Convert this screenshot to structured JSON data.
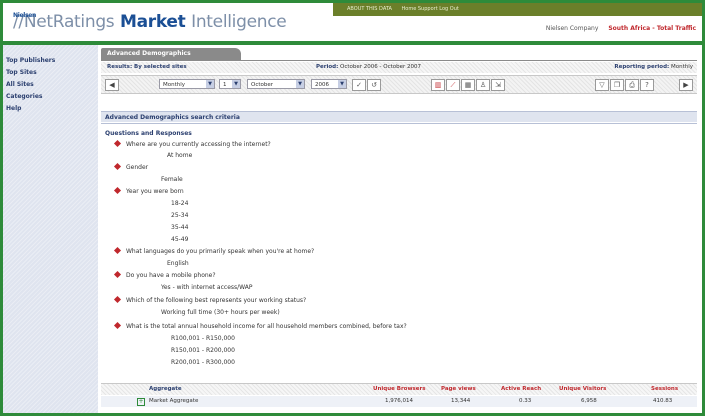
{
  "header": {
    "logo_part1": "Nielsen",
    "logo_part2": "//",
    "logo_part3": "NetRatings",
    "logo_part4": "Market",
    "logo_part5": "Intelligence",
    "topband_left": "ABOUT THIS DATA",
    "topband_right": "Home  Support  Log Out",
    "company": "Nielsen Company",
    "region": "South Africa - Total Traffic"
  },
  "sidebar": {
    "items": [
      {
        "label": "Top Publishers"
      },
      {
        "label": "Top Sites"
      },
      {
        "label": "All Sites"
      },
      {
        "label": "Categories"
      },
      {
        "label": "Help"
      }
    ]
  },
  "main": {
    "tab_label": "Advanced Demographics",
    "info": {
      "left": "Results: By selected sites",
      "period_label": "Period:",
      "period_value": "October 2006 - October 2007",
      "reporting_label": "Reporting period:",
      "reporting_value": "Monthly"
    },
    "toolbar": {
      "frequency": "Monthly",
      "day": "1",
      "month": "October",
      "year": "2006"
    },
    "section_title": "Advanced Demographics search criteria",
    "qa_title": "Questions and Responses",
    "questions": [
      {
        "q": "Where are you currently accessing the internet?",
        "answers": [
          "At home"
        ]
      },
      {
        "q": "Gender",
        "answers": [
          "Female"
        ]
      },
      {
        "q": "Year you were born",
        "answers": [
          "18-24",
          "25-34",
          "35-44",
          "45-49"
        ]
      },
      {
        "q": "What languages do you primarily speak when you're at home?",
        "answers": [
          "English"
        ]
      },
      {
        "q": "Do you have a mobile phone?",
        "answers": [
          "Yes - with internet access/WAP"
        ]
      },
      {
        "q": "Which of the following best represents your working status?",
        "answers": [
          "Working full time (30+ hours per week)"
        ]
      },
      {
        "q": "What is the total annual household income for all household members combined, before tax?",
        "answers": [
          "R100,001 - R150,000",
          "R150,001 - R200,000",
          "R200,001 - R300,000"
        ]
      }
    ],
    "grid": {
      "headers": [
        "Aggregate",
        "Unique Browsers",
        "Page views",
        "Active Reach",
        "Unique Visitors",
        "Sessions"
      ],
      "row": {
        "label": "Market Aggregate",
        "values": [
          "1,976,014",
          "13,344",
          "0.33",
          "6,958",
          "410.83"
        ]
      }
    }
  }
}
